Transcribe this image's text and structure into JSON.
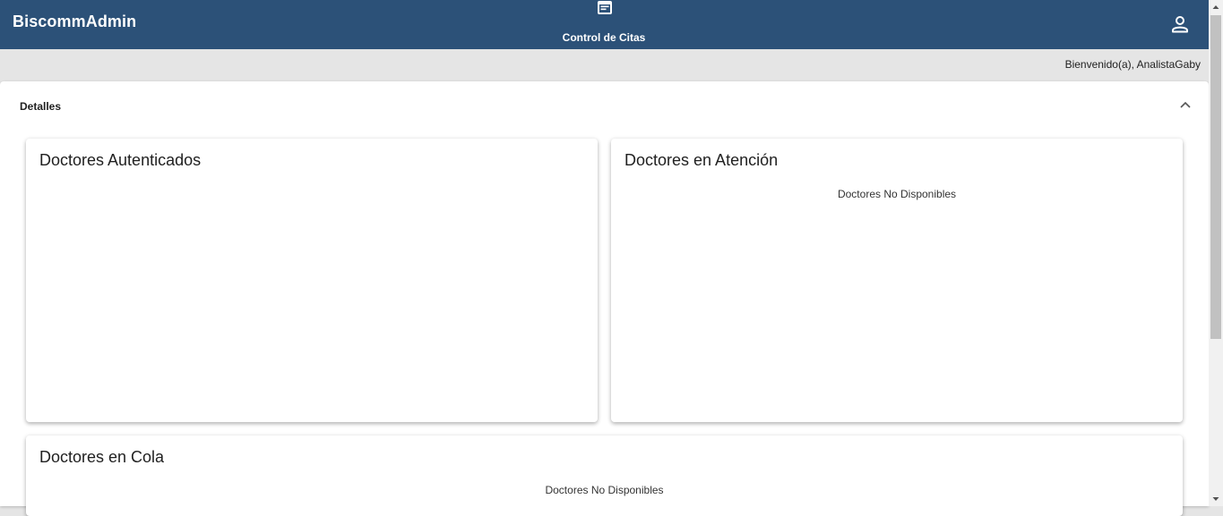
{
  "app": {
    "brand": "BiscommAdmin",
    "nav": {
      "label": "Control de Citas",
      "icon": "calendar-note-icon"
    },
    "user_icon": "person-icon",
    "welcome": "Bienvenido(a), AnalistaGaby",
    "colors": {
      "header": "#2c5178",
      "background": "#e5e5e5",
      "card": "#ffffff"
    }
  },
  "details": {
    "title": "Detalles",
    "toggle_icon": "chevron-up-icon",
    "cards": [
      {
        "title": "Doctores Autenticados",
        "empty_text": ""
      },
      {
        "title": "Doctores en Atención",
        "empty_text": "Doctores No Disponibles"
      },
      {
        "title": "Doctores en Cola",
        "empty_text": "Doctores No Disponibles"
      }
    ]
  }
}
